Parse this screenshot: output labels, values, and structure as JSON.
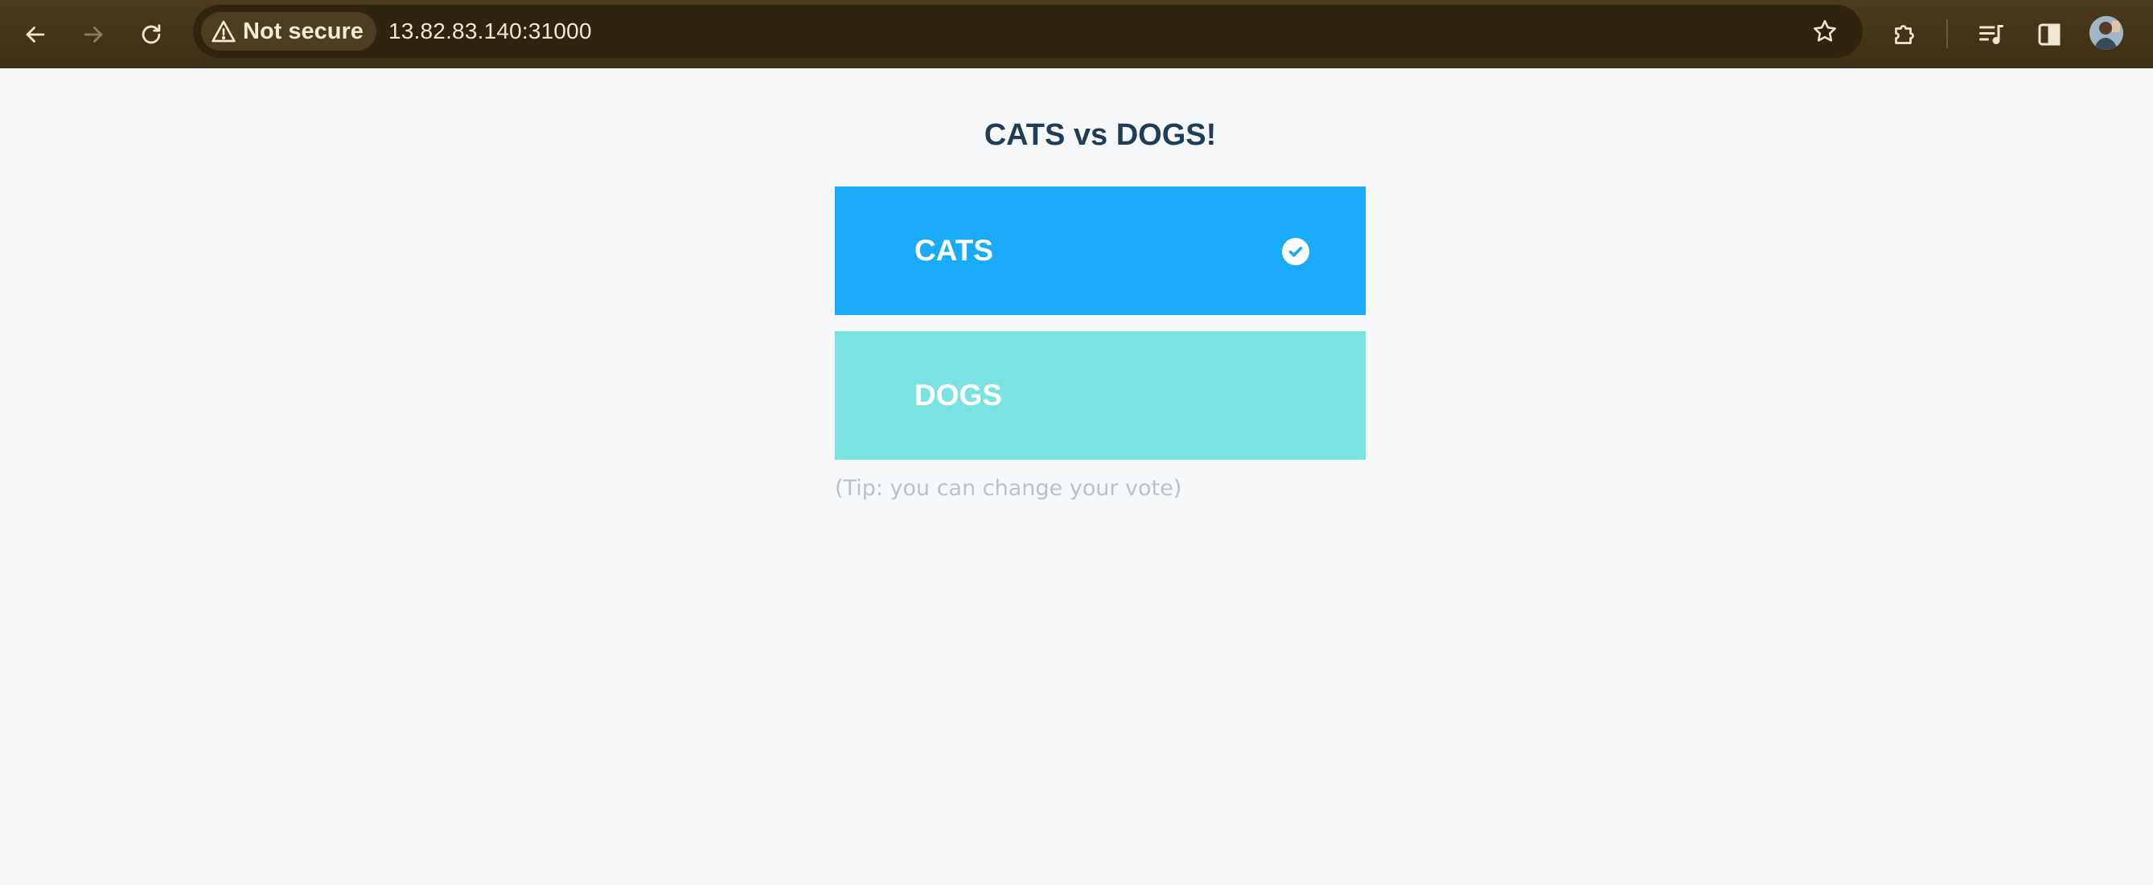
{
  "browser": {
    "security_label": "Not secure",
    "url": "13.82.83.140:31000",
    "icons": [
      "back-arrow-icon",
      "forward-arrow-icon",
      "reload-icon",
      "warning-icon",
      "star-icon",
      "extensions-icon",
      "media-controls-icon",
      "side-panel-icon",
      "profile-avatar"
    ]
  },
  "page": {
    "title": "CATS vs DOGS!",
    "options": [
      {
        "label": "CATS",
        "selected": true,
        "color": "#1aabf8"
      },
      {
        "label": "DOGS",
        "selected": false,
        "color": "#7be2e2"
      }
    ],
    "tip": "(Tip: you can change your vote)"
  },
  "colors": {
    "toolbar": "#4a3a1e",
    "page_background": "#f6f8fa",
    "title": "#1f3d56",
    "tip": "#b7c2ce"
  }
}
